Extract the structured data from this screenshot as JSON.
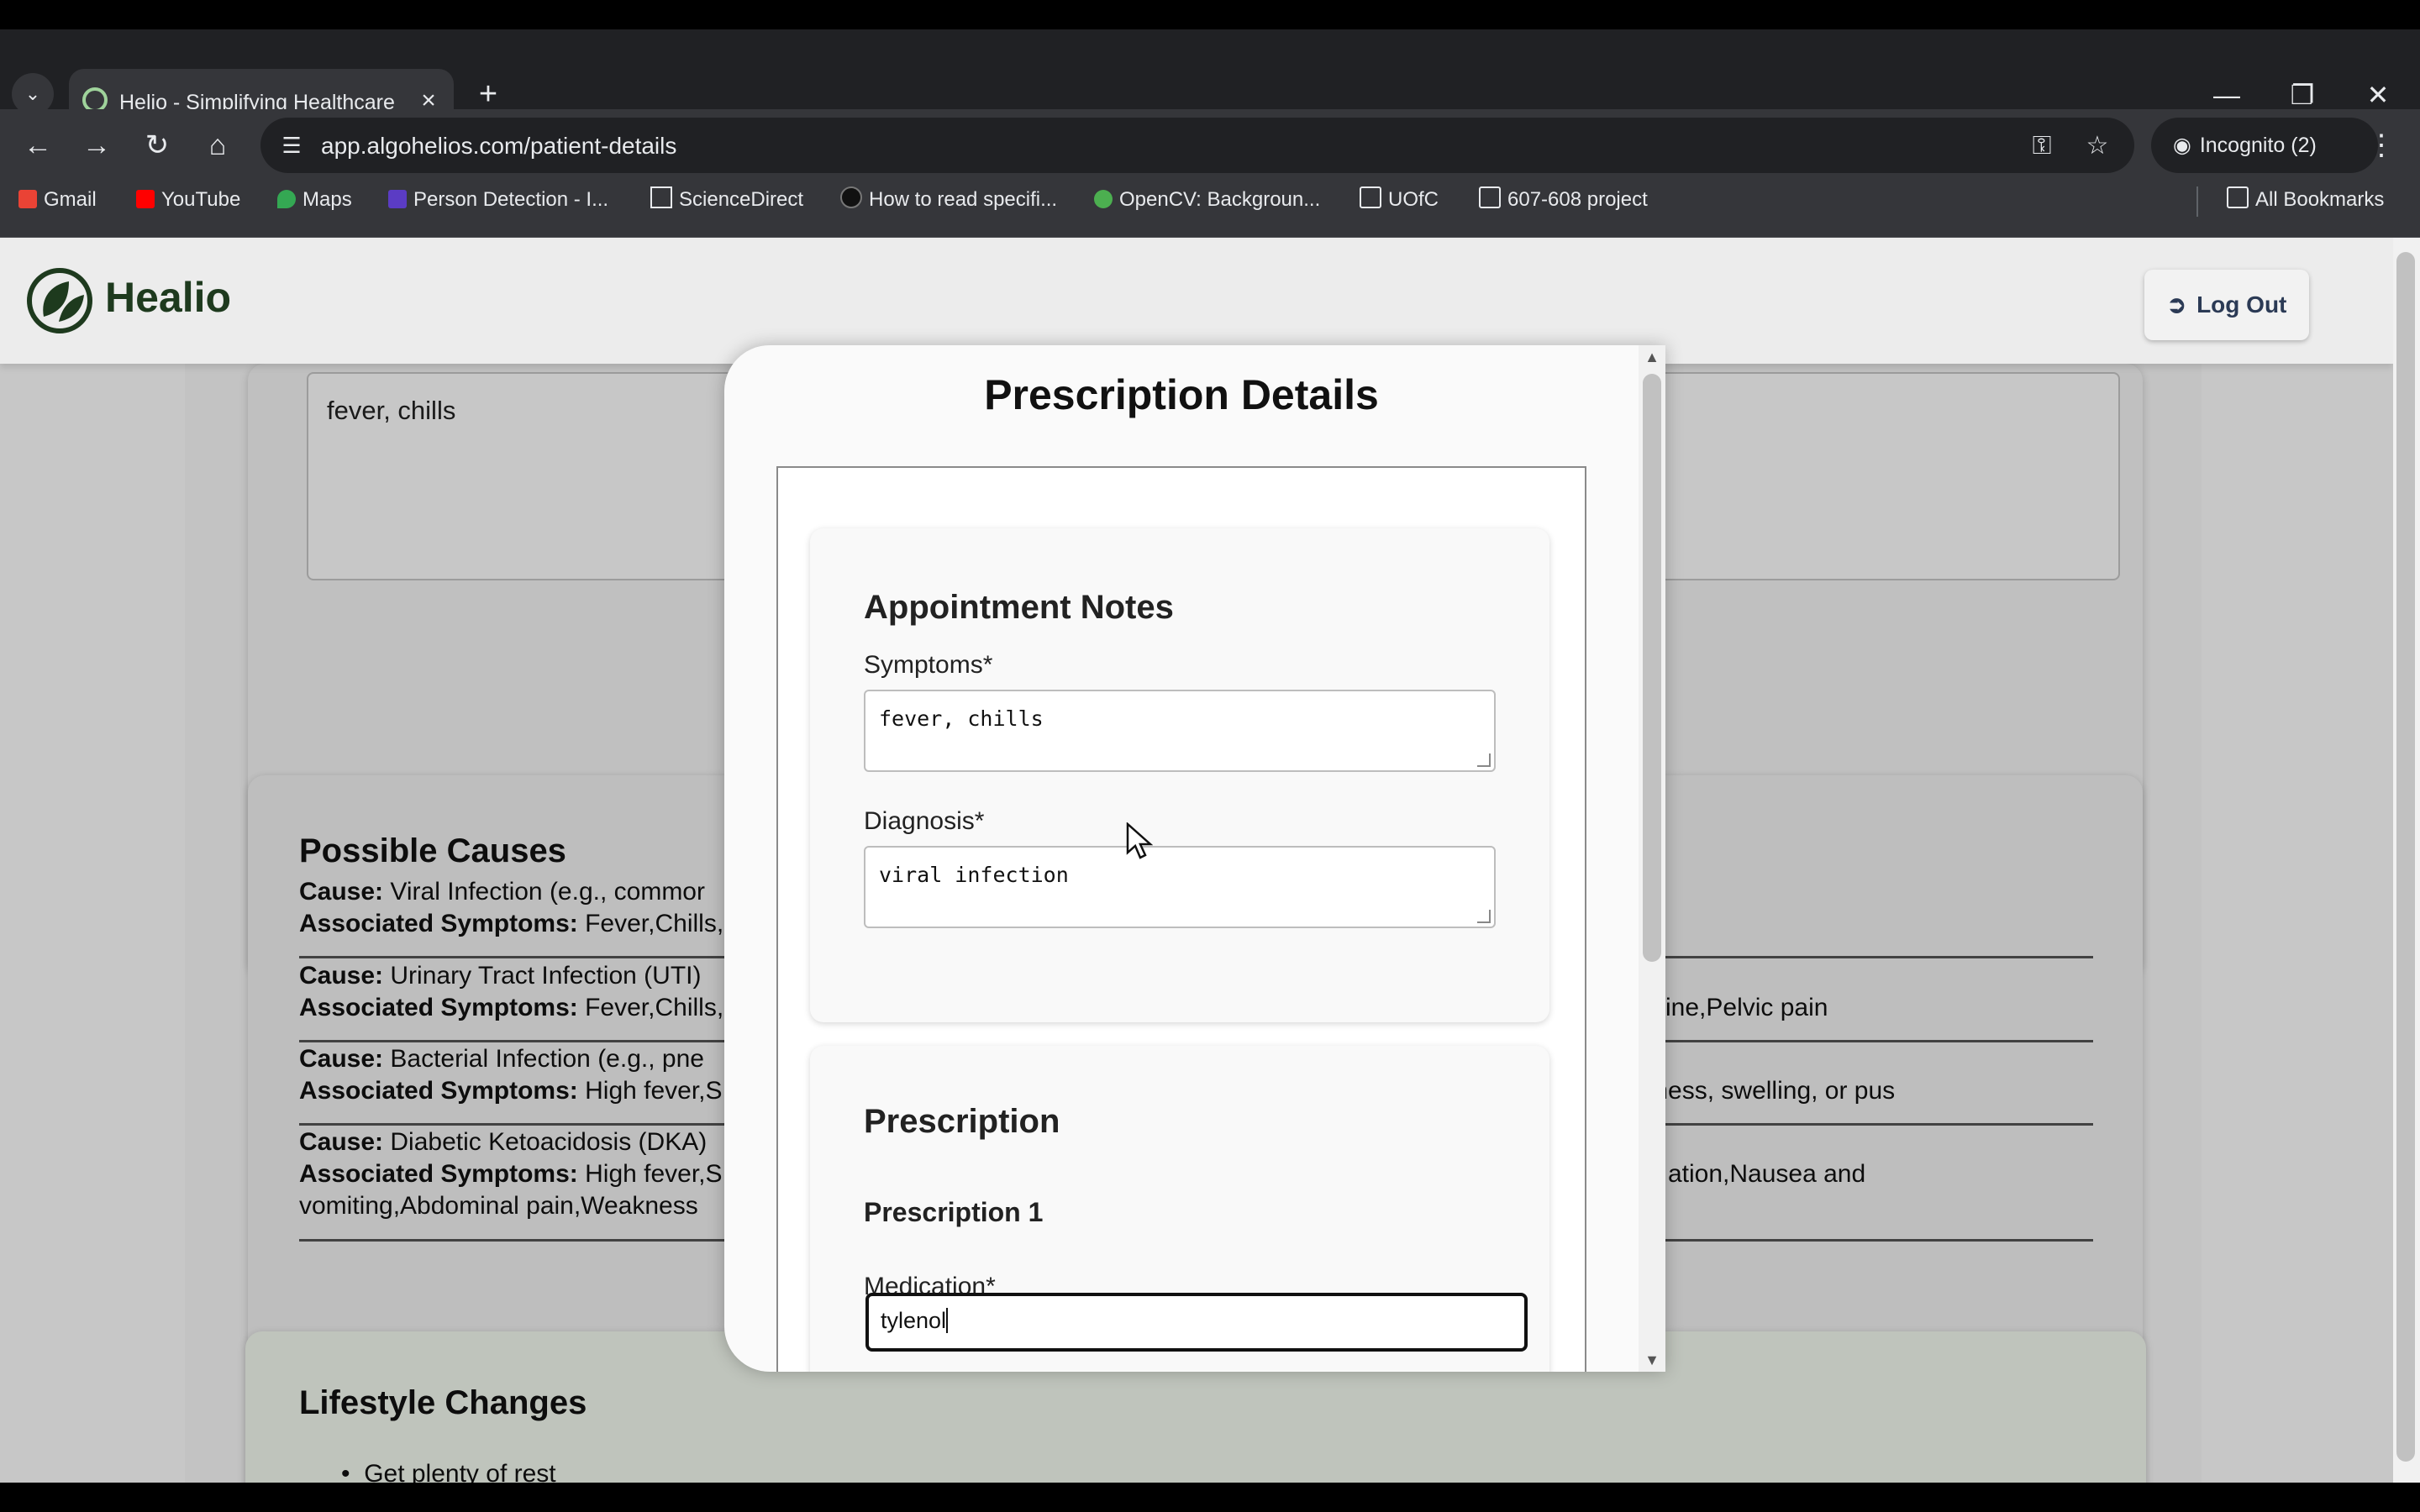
{
  "browser": {
    "tab_title": "Helio - Simplifying Healthcare •",
    "url": "app.algohelios.com/patient-details",
    "incognito_label": "Incognito (2)",
    "bookmarks": [
      {
        "label": "Gmail",
        "color": "#ea4335"
      },
      {
        "label": "YouTube",
        "color": "#ff0000"
      },
      {
        "label": "Maps",
        "color": "#34a853"
      },
      {
        "label": "Person Detection - I...",
        "color": "#5b3cc4"
      },
      {
        "label": "ScienceDirect",
        "color": "#e8eaed"
      },
      {
        "label": "How to read specifi...",
        "color": "#202124"
      },
      {
        "label": "OpenCV: Backgroun...",
        "color": "#4caf50"
      },
      {
        "label": "UOfC",
        "color": "#e8eaed"
      },
      {
        "label": "607-608 project",
        "color": "#e8eaed"
      }
    ],
    "all_bookmarks_label": "All Bookmarks"
  },
  "app": {
    "brand": "Healio",
    "logout_label": "Log Out",
    "accent_color": "#2e7d32"
  },
  "background": {
    "symptoms_value": "fever, chills",
    "possible_causes_title": "Possible Causes",
    "causes": [
      {
        "cause_label": "Cause:",
        "cause_text": "Viral Infection (e.g., commor",
        "sym_label": "Associated Symptoms:",
        "sym_text": "Fever,Chills,",
        "sym_right": ""
      },
      {
        "cause_label": "Cause:",
        "cause_text": "Urinary Tract Infection (UTI)",
        "sym_label": "Associated Symptoms:",
        "sym_text": "Fever,Chills,",
        "sym_right": "ine,Pelvic pain"
      },
      {
        "cause_label": "Cause:",
        "cause_text": "Bacterial Infection (e.g., pne",
        "sym_label": "Associated Symptoms:",
        "sym_text": "High fever,S",
        "sym_right": "edness, swelling, or pus"
      },
      {
        "cause_label": "Cause:",
        "cause_text": "Diabetic Ketoacidosis (DKA)",
        "sym_label": "Associated Symptoms:",
        "sym_text": "High fever,S",
        "sym_right": "ation,Nausea and",
        "sym_line2": "vomiting,Abdominal pain,Weakness"
      }
    ],
    "lifestyle_title": "Lifestyle Changes",
    "lifestyle_items": [
      "Get plenty of rest"
    ]
  },
  "modal": {
    "title": "Prescription Details",
    "notes_title": "Appointment Notes",
    "symptoms_label": "Symptoms*",
    "symptoms_value": "fever, chills",
    "diagnosis_label": "Diagnosis*",
    "diagnosis_value": "viral infection",
    "prescription_title": "Prescription",
    "prescription_item_title": "Prescription 1",
    "medication_label": "Medication*",
    "medication_value": "tylenol"
  },
  "icons": [
    "chevron-down-icon",
    "favicon-icon",
    "close-icon",
    "plus-icon",
    "minimize-icon",
    "restore-icon",
    "back-icon",
    "forward-icon",
    "reload-icon",
    "home-icon",
    "site-info-icon",
    "key-icon",
    "star-icon",
    "incognito-icon",
    "menu-icon",
    "folder-icon",
    "logout-icon",
    "leaf-logo-icon",
    "mouse-cursor-icon"
  ]
}
